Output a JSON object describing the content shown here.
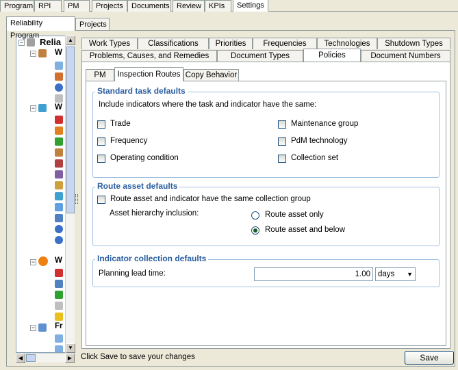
{
  "top_tabs": [
    "Program",
    "RPI",
    "PM",
    "Projects",
    "Documents",
    "Review",
    "KPIs",
    "Settings"
  ],
  "settings_tabs": {
    "reliability_program": "Reliability Program",
    "projects": "Projects"
  },
  "tree": {
    "root_label": "Relia",
    "node_w": "W",
    "node_fr": "Fr"
  },
  "policy_tabs_row1": [
    "Work Types",
    "Classifications",
    "Priorities",
    "Frequencies",
    "Technologies",
    "Shutdown Types"
  ],
  "policy_tabs_row2": [
    "Problems, Causes, and Remedies",
    "Document Types",
    "Policies",
    "Document Numbers"
  ],
  "inner_tabs": [
    "PM",
    "Inspection Routes",
    "Copy Behavior"
  ],
  "standard": {
    "title": "Standard task defaults",
    "intro": "Include indicators where the task and indicator have the same:",
    "trade": "Trade",
    "frequency": "Frequency",
    "operating_condition": "Operating condition",
    "maintenance_group": "Maintenance group",
    "pdm_technology": "PdM technology",
    "collection_set": "Collection set"
  },
  "route": {
    "title": "Route asset defaults",
    "same_group": "Route asset and indicator have the same collection group",
    "hierarchy_label": "Asset hierarchy inclusion:",
    "opt_only": "Route asset only",
    "opt_below": "Route asset and below",
    "selected": "Route asset and below"
  },
  "indicator": {
    "title": "Indicator collection defaults",
    "lead_label": "Planning lead time:",
    "lead_value": "1.00",
    "unit": "days"
  },
  "footer": {
    "hint": "Click Save to save your changes",
    "save": "Save"
  }
}
